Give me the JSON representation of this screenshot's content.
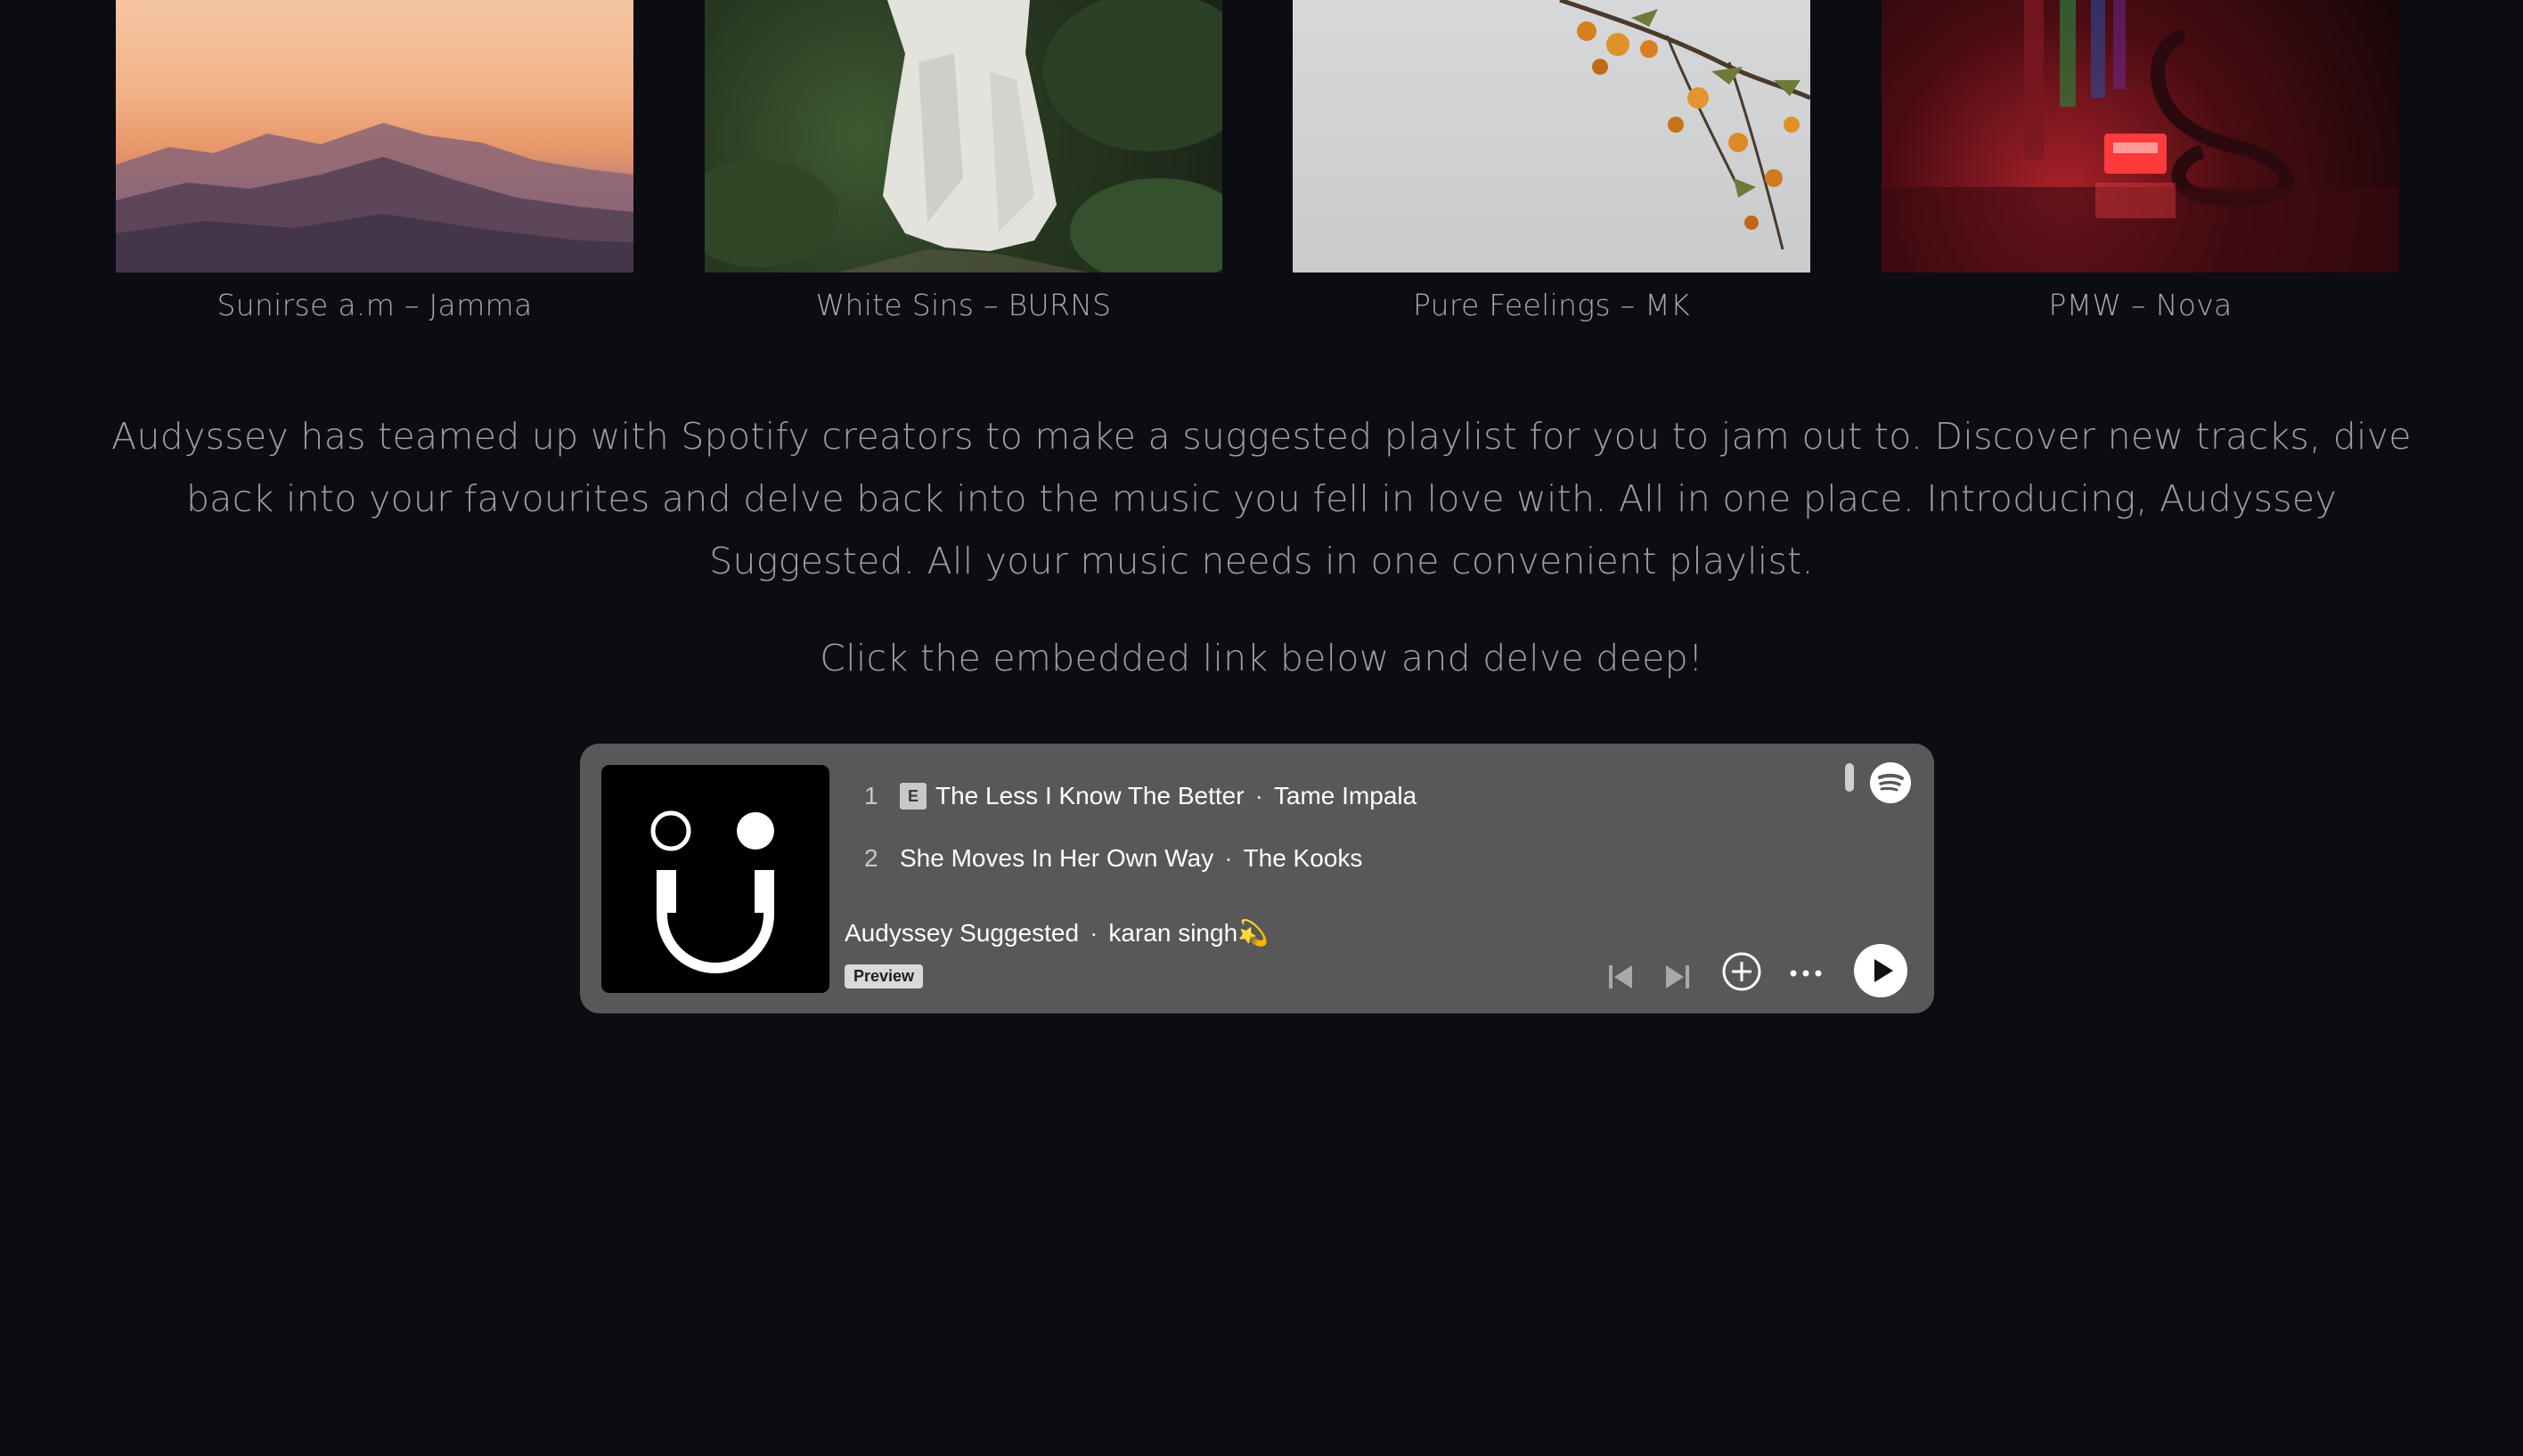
{
  "albums": [
    {
      "caption": "Sunirse a.m – Jamma"
    },
    {
      "caption": "White Sins – BURNS"
    },
    {
      "caption": "Pure Feelings – MK"
    },
    {
      "caption": "PMW – Nova"
    }
  ],
  "intro": {
    "text": "Audyssey has teamed up with Spotify creators to make a suggested playlist for you to jam out to. Discover new tracks, dive back into your favourites and delve back into the music you fell in love with. All in one place. Introducing, Audyssey Suggested. All your music needs in one convenient playlist.",
    "cta": "Click the embedded link below and delve deep!"
  },
  "embed": {
    "background": "#585858",
    "tracks": [
      {
        "number": "1",
        "explicit": "E",
        "title": "The Less I Know The Better",
        "separator": "·",
        "artist": "Tame Impala"
      },
      {
        "number": "2",
        "title": "She Moves In Her Own Way",
        "separator": "·",
        "artist": "The Kooks"
      }
    ],
    "playlist_name": "Audyssey Suggested",
    "separator": "·",
    "owner": "karan singh💫",
    "preview_label": "Preview",
    "icons": [
      "spotify-logo-icon",
      "skip-back-icon",
      "skip-forward-icon",
      "add-icon",
      "more-options-icon",
      "play-icon"
    ]
  }
}
